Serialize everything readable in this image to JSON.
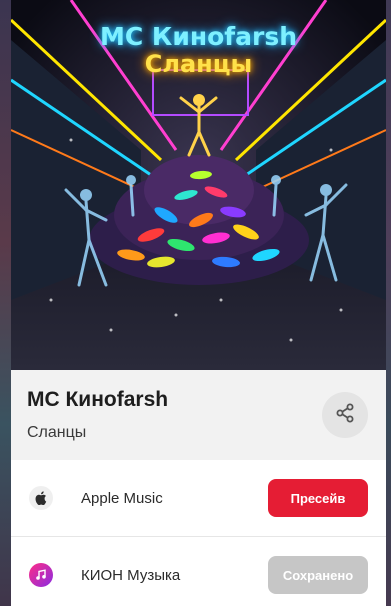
{
  "cover": {
    "title": "МС Кинofarsh",
    "subtitle": "Сланцы"
  },
  "release": {
    "artist": "МС Кинofarsh",
    "track": "Сланцы"
  },
  "share": {
    "icon": "share-icon"
  },
  "services": [
    {
      "name": "Apple Music",
      "icon": "apple-logo-icon",
      "action": "Пресейв",
      "action_color": "#e51d34"
    },
    {
      "name": "КИОН Музыка",
      "icon": "kion-music-icon",
      "action": "Сохранено",
      "action_color": "#c6c6c6"
    }
  ]
}
